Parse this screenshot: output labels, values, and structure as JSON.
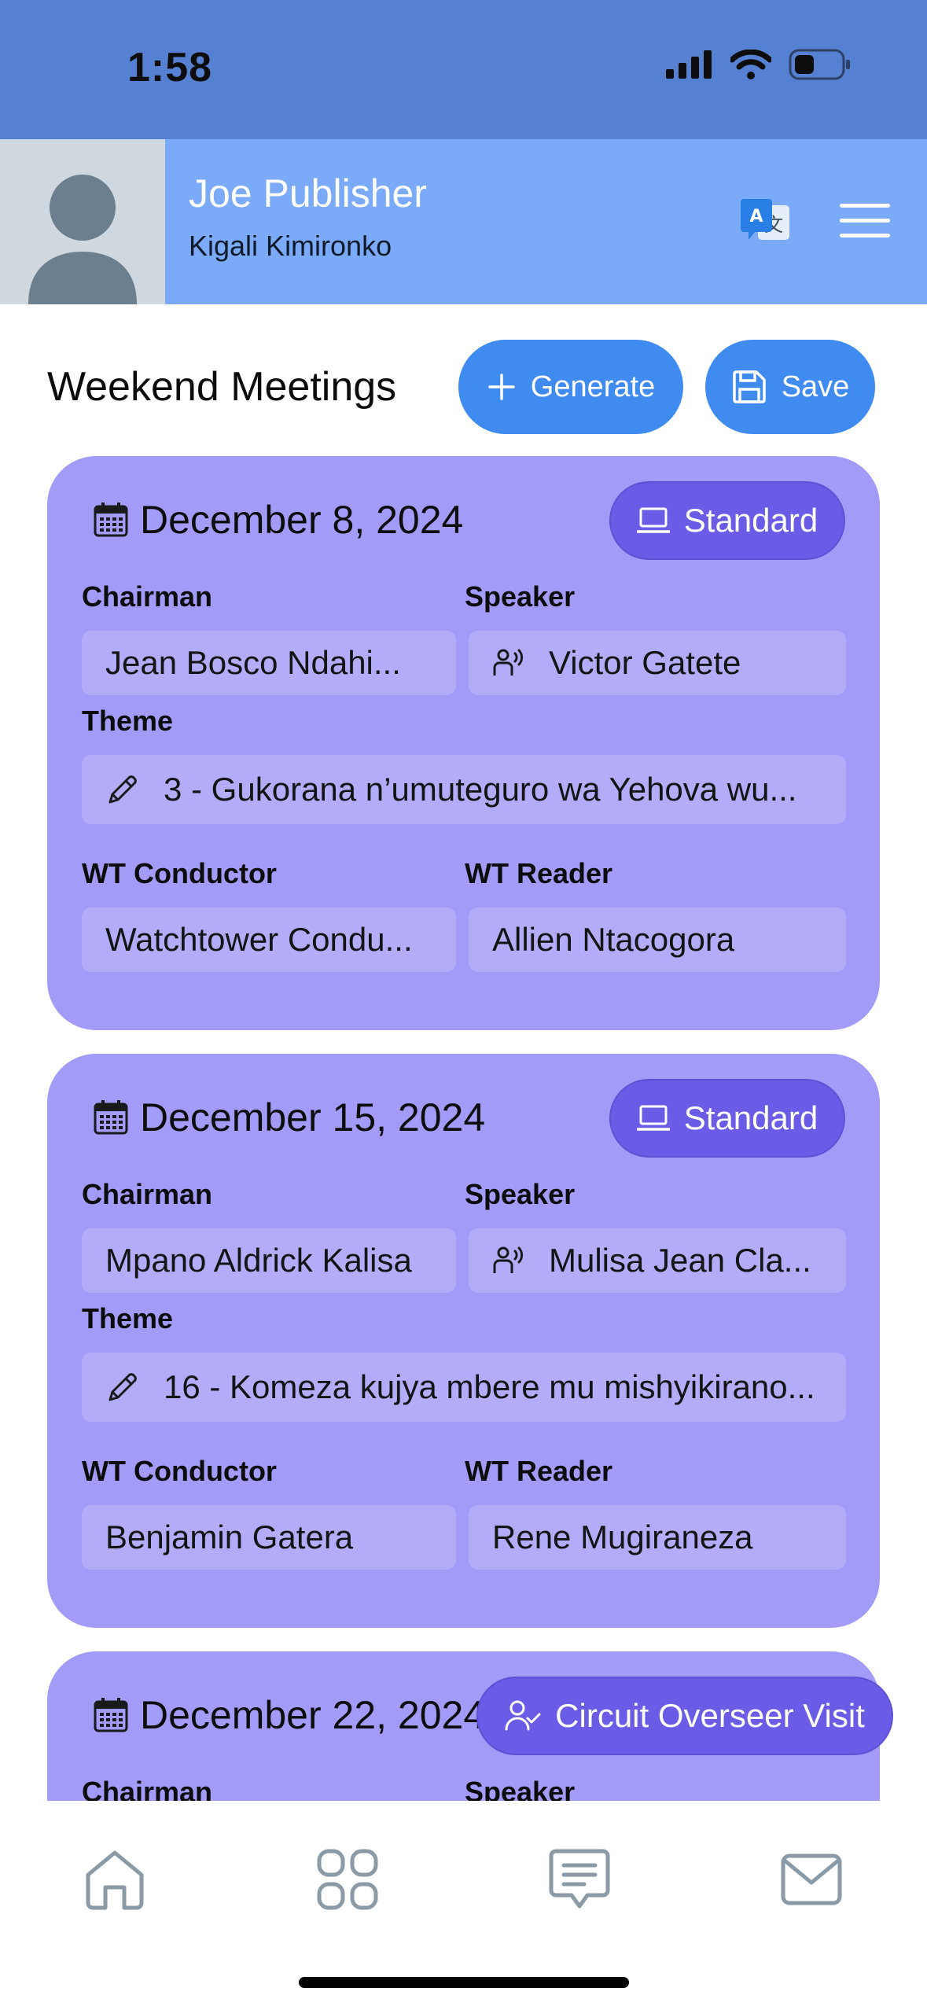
{
  "status_bar": {
    "time": "1:58"
  },
  "profile": {
    "name": "Joe Publisher",
    "congregation": "Kigali Kimironko"
  },
  "header": {
    "title": "Weekend Meetings",
    "generate_label": "Generate",
    "save_label": "Save"
  },
  "labels": {
    "chairman": "Chairman",
    "speaker": "Speaker",
    "theme": "Theme",
    "wt_conductor": "WT Conductor",
    "wt_reader": "WT Reader"
  },
  "meetings": [
    {
      "date": "December 8, 2024",
      "type": "Standard",
      "chairman": "Jean Bosco Ndahi...",
      "speaker": "Victor Gatete",
      "theme": "3 - Gukorana n’umuteguro wa Yehova wu...",
      "wt_conductor": "Watchtower Condu...",
      "wt_reader": "Allien Ntacogora"
    },
    {
      "date": "December 15, 2024",
      "type": "Standard",
      "chairman": "Mpano Aldrick Kalisa",
      "speaker": "Mulisa Jean Cla...",
      "theme": "16 - Komeza kujya mbere mu mishyikirano...",
      "wt_conductor": "Benjamin Gatera",
      "wt_reader": "Rene  Mugiraneza"
    },
    {
      "date": "December 22, 2024",
      "type": "Circuit Overseer Visit"
    }
  ],
  "icons": [
    "signal-icon",
    "wifi-icon",
    "battery-icon",
    "translate-icon",
    "menu-icon",
    "plus-icon",
    "save-icon",
    "calendar-icon",
    "laptop-icon",
    "speaker-icon",
    "pencil-icon",
    "user-check-icon",
    "home-icon",
    "grid-icon",
    "message-icon",
    "mail-icon"
  ],
  "colors": {
    "status_bar": "#5680d2",
    "profile_bar": "#7aaaf8",
    "accent": "#3f8bef",
    "card": "#a39bf8",
    "field": "#b3adf9",
    "pill": "#6a5ce6",
    "nav_icon": "#8a9aa6"
  }
}
